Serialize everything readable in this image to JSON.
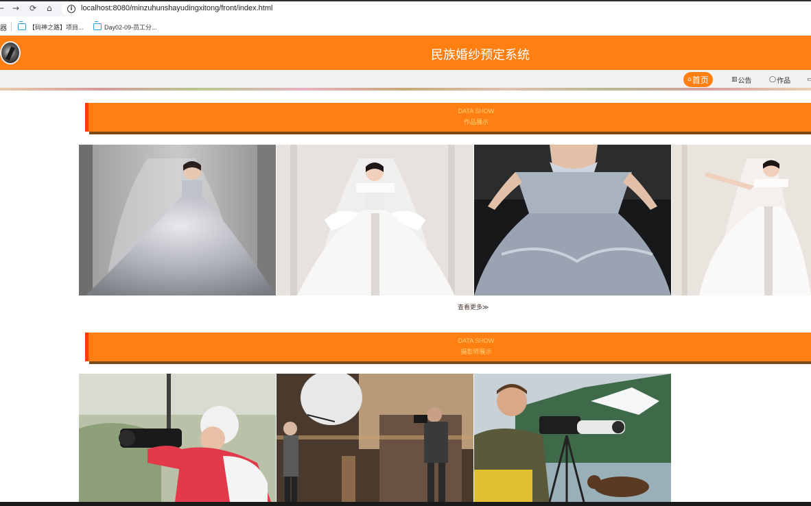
{
  "browser": {
    "back": "←",
    "forward": "→",
    "reload": "⟳",
    "home": "⌂",
    "url": "localhost:8080/minzuhunshayudingxitong/front/index.html"
  },
  "bookmarks": {
    "apps_label": "器",
    "items": [
      {
        "label": "【码神之路】项目..."
      },
      {
        "label": "Day02-09-员工分..."
      }
    ]
  },
  "header": {
    "title": "民族婚纱预定系统"
  },
  "nav": {
    "items": [
      {
        "icon": "⌂",
        "label": "首页"
      },
      {
        "icon": "▥",
        "label": "公告"
      },
      {
        "icon": "◯",
        "label": "作品"
      },
      {
        "icon": "▭",
        "label": ""
      }
    ]
  },
  "sections": [
    {
      "en": "DATA SHOW",
      "cn": "作品展示"
    },
    {
      "en": "DATA SHOW",
      "cn": "摄影师展示"
    }
  ],
  "more_link": "查看更多≫",
  "colors": {
    "brand": "#ff7f12",
    "banner_accent": "#ff3d00",
    "banner_text": "#ffd27a"
  }
}
